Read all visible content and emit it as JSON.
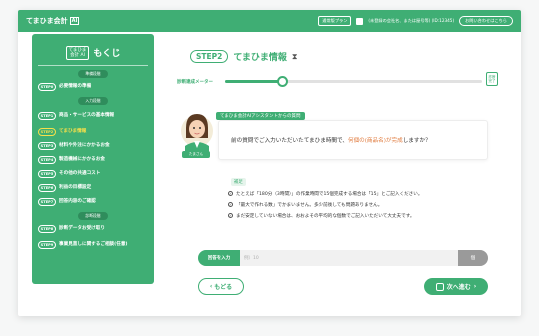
{
  "header": {
    "logo_text": "てまひま会計",
    "logo_badge": "AI",
    "plan_label": "通常版プラン",
    "user_text": "(未登録の会社名、または屋号等) (ID:12345)",
    "contact_label": "お問い合わせはこちら"
  },
  "sidebar": {
    "logo_line1": "てまひま",
    "logo_line2": "会計 AI",
    "title": "もくじ",
    "section_prep": "準備段階",
    "section_input": "入力段階",
    "section_diag": "診断段階",
    "steps": [
      {
        "pill": "STEP0",
        "label": "必要情報の準備"
      },
      {
        "pill": "STEP1",
        "label": "商品・サービスの基本情報"
      },
      {
        "pill": "STEP2",
        "label": "てまひま情報"
      },
      {
        "pill": "STEP3",
        "label": "材料や外注にかかるお金"
      },
      {
        "pill": "STEP4",
        "label": "製造機械にかかるお金"
      },
      {
        "pill": "STEP5",
        "label": "その他の共通コスト"
      },
      {
        "pill": "STEP6",
        "label": "利益の目標設定"
      },
      {
        "pill": "STEP7",
        "label": "回答内容のご確認"
      },
      {
        "pill": "STEP8",
        "label": "診断データお受け取り"
      },
      {
        "pill": "STEP9",
        "label": "事業見直しに関するご相談(任意)"
      }
    ]
  },
  "main": {
    "step_pill": "STEP2",
    "step_title": "てまひま情報",
    "progress_label": "診断達成メーター",
    "progress_value": 0.22,
    "goal_label": "診断完了",
    "assistant_label": "てまひま会計AIアシスタントからの質問",
    "avatar_name": "たまさん",
    "question_before": "前の質問でご入力いただいたてまひま時間で、",
    "question_highlight": "何個の(商品名)が完成",
    "question_after": "しますか？",
    "hint_tag": "補足",
    "hints": [
      "たとえば「180分（3時間）」の作業時間で15個完成する場合は「15」とご記入ください。",
      "「最大で作れる数」でかまいません。多少前後しても問題ありません。",
      "まだ安定していない場合は、おおよその平均的な個数でご記入いただいて大丈夫です。"
    ],
    "answer_label": "回答を入力",
    "answer_placeholder": "例）10",
    "unit": "個",
    "back_label": "もどる",
    "next_label": "次へ進む"
  },
  "colors": {
    "brand_green": "#3fae74",
    "highlight_orange": "#e07a3d",
    "active_yellow": "#f7e04a"
  }
}
